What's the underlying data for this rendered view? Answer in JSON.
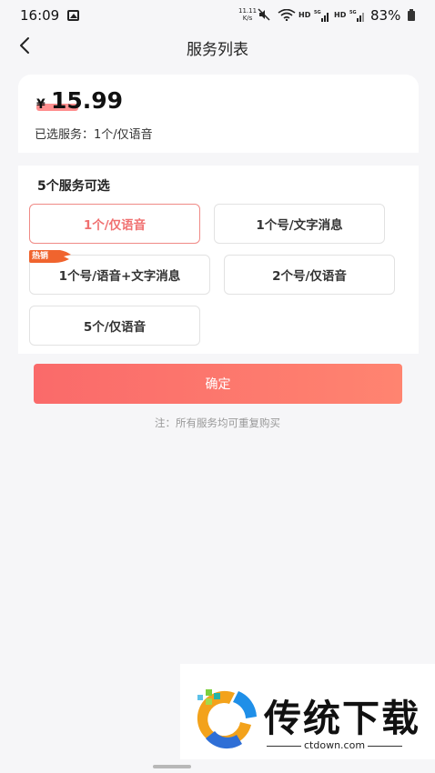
{
  "status_bar": {
    "time": "16:09",
    "speed_value": "11.11",
    "speed_unit": "K/s",
    "hd_1": "HD",
    "hd_2": "HD",
    "battery_percent": "83%"
  },
  "nav": {
    "title": "服务列表"
  },
  "price_card": {
    "currency": "¥",
    "price": "15.99",
    "selected_label": "已选服务：",
    "selected_value": "1个/仅语音"
  },
  "services": {
    "heading": "5个服务可选",
    "hot_badge": "热销",
    "options": [
      {
        "label": "1个/仅语音",
        "selected": true
      },
      {
        "label": "1个号/文字消息",
        "selected": false
      },
      {
        "label": "1个号/语音+文字消息",
        "selected": false
      },
      {
        "label": "2个号/仅语音",
        "selected": false
      },
      {
        "label": "5个/仅语音",
        "selected": false
      }
    ]
  },
  "confirm_label": "确定",
  "footnote": "注：所有服务均可重复购买",
  "watermark": {
    "title": "传统下载",
    "url": "ctdown.com"
  },
  "colors": {
    "accent": "#f07070",
    "button_start": "#fa6a6a",
    "button_end": "#ff8470",
    "background": "#f6f6f8"
  }
}
